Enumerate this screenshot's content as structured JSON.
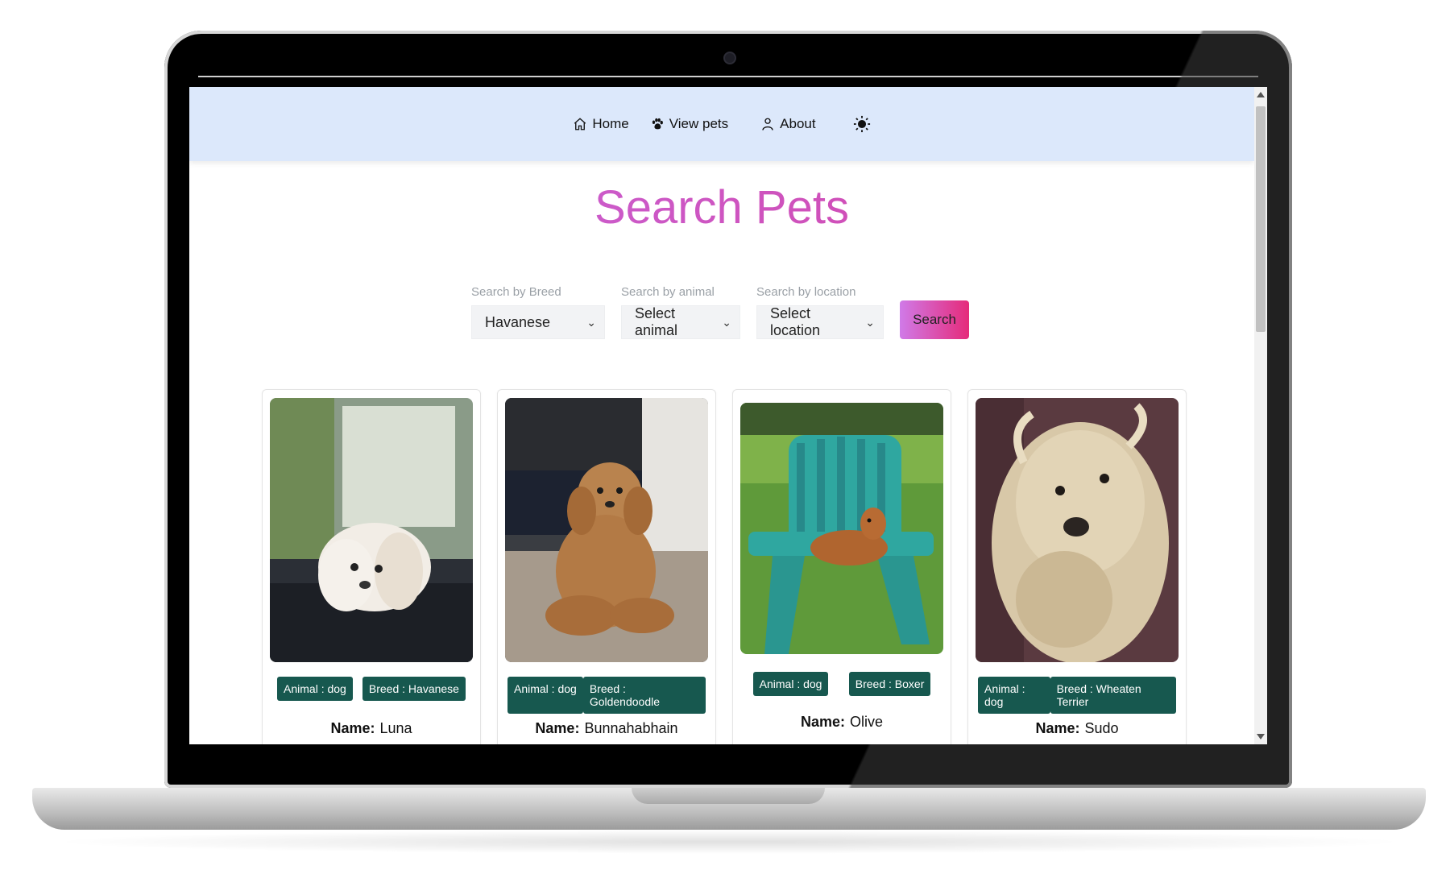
{
  "nav": {
    "home_label": "Home",
    "view_pets_label": "View pets",
    "about_label": "About"
  },
  "page": {
    "title": "Search Pets"
  },
  "search": {
    "breed_label": "Search by Breed",
    "breed_value": "Havanese",
    "animal_label": "Search by animal",
    "animal_value": "Select animal",
    "location_label": "Search by location",
    "location_value": "Select location",
    "button_label": "Search"
  },
  "pets": [
    {
      "animal": "Animal : dog",
      "breed": "Breed : Havanese",
      "name_label": "Name:",
      "name": "Luna"
    },
    {
      "animal": "Animal : dog",
      "breed": "Breed : Goldendoodle",
      "name_label": "Name:",
      "name": "Bunnahabhain"
    },
    {
      "animal": "Animal : dog",
      "breed": "Breed : Boxer",
      "name_label": "Name:",
      "name": "Olive"
    },
    {
      "animal": "Animal : dog",
      "breed": "Breed : Wheaten Terrier",
      "name_label": "Name:",
      "name": "Sudo"
    }
  ],
  "colors": {
    "navbar_bg": "#dce8fb",
    "title_gradient_start": "#c56be3",
    "title_gradient_end": "#d63f9f",
    "tag_bg": "#17584f",
    "button_gradient_start": "#d07ae8",
    "button_gradient_end": "#e52b7a"
  },
  "icons": {
    "home": "home-icon",
    "view_pets": "paw-icon",
    "about": "person-icon",
    "theme": "sun-icon",
    "select_arrow": "chevron-down-icon"
  }
}
